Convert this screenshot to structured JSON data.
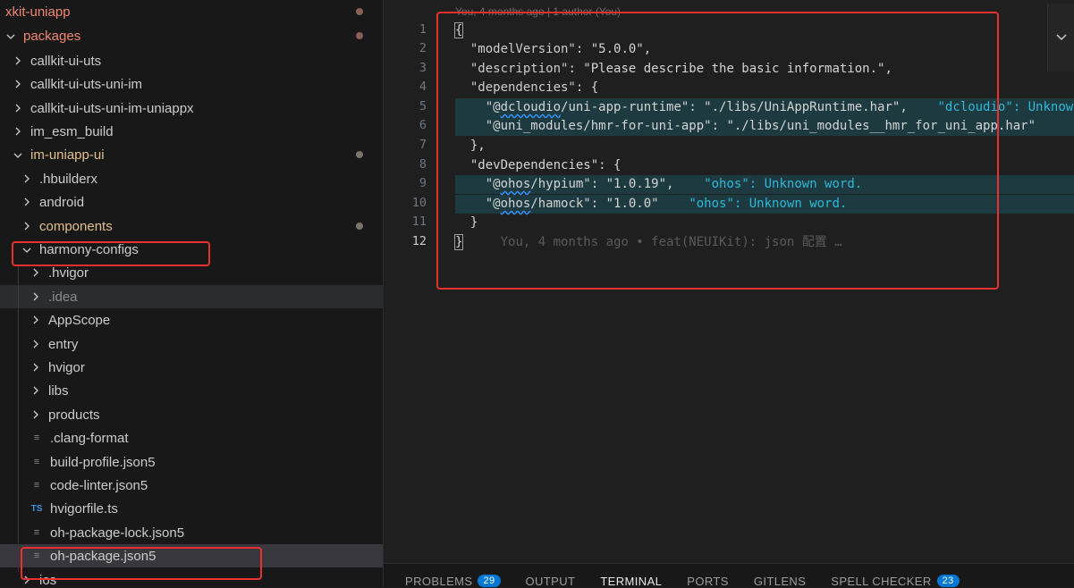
{
  "sidebar": {
    "items": [
      {
        "label": "xkit-uniapp",
        "chevron": "",
        "icon": "",
        "color": "red",
        "dot": "red"
      },
      {
        "label": "packages",
        "chevron": "down",
        "icon": "",
        "color": "red",
        "dot": "red"
      },
      {
        "label": "callkit-ui-uts",
        "chevron": "right",
        "icon": "",
        "color": "",
        "dot": ""
      },
      {
        "label": "callkit-ui-uts-uni-im",
        "chevron": "right",
        "icon": "",
        "color": "",
        "dot": ""
      },
      {
        "label": "callkit-ui-uts-uni-im-uniappx",
        "chevron": "right",
        "icon": "",
        "color": "",
        "dot": ""
      },
      {
        "label": "im_esm_build",
        "chevron": "right",
        "icon": "",
        "color": "",
        "dot": ""
      },
      {
        "label": "im-uniapp-ui",
        "chevron": "down",
        "icon": "",
        "color": "yellow",
        "dot": "gray"
      },
      {
        "label": ".hbuilderx",
        "chevron": "right",
        "icon": "",
        "color": "",
        "dot": ""
      },
      {
        "label": "android",
        "chevron": "right",
        "icon": "",
        "color": "",
        "dot": ""
      },
      {
        "label": "components",
        "chevron": "right",
        "icon": "",
        "color": "yellow",
        "dot": "gray"
      },
      {
        "label": "harmony-configs",
        "chevron": "down",
        "icon": "",
        "color": "",
        "dot": ""
      },
      {
        "label": ".hvigor",
        "chevron": "right",
        "icon": "",
        "color": "",
        "dot": ""
      },
      {
        "label": ".idea",
        "chevron": "right",
        "icon": "",
        "color": "dim",
        "dot": ""
      },
      {
        "label": "AppScope",
        "chevron": "right",
        "icon": "",
        "color": "",
        "dot": ""
      },
      {
        "label": "entry",
        "chevron": "right",
        "icon": "",
        "color": "",
        "dot": ""
      },
      {
        "label": "hvigor",
        "chevron": "right",
        "icon": "",
        "color": "",
        "dot": ""
      },
      {
        "label": "libs",
        "chevron": "right",
        "icon": "",
        "color": "",
        "dot": ""
      },
      {
        "label": "products",
        "chevron": "right",
        "icon": "",
        "color": "",
        "dot": ""
      },
      {
        "label": ".clang-format",
        "chevron": "",
        "icon": "lines",
        "color": "",
        "dot": ""
      },
      {
        "label": "build-profile.json5",
        "chevron": "",
        "icon": "lines",
        "color": "",
        "dot": ""
      },
      {
        "label": "code-linter.json5",
        "chevron": "",
        "icon": "lines",
        "color": "",
        "dot": ""
      },
      {
        "label": "hvigorfile.ts",
        "chevron": "",
        "icon": "ts",
        "color": "",
        "dot": ""
      },
      {
        "label": "oh-package-lock.json5",
        "chevron": "",
        "icon": "lines",
        "color": "",
        "dot": ""
      },
      {
        "label": "oh-package.json5",
        "chevron": "",
        "icon": "lines",
        "color": "",
        "dot": ""
      },
      {
        "label": "ios",
        "chevron": "right",
        "icon": "",
        "color": "",
        "dot": ""
      }
    ],
    "icon_text": {
      "ts": "TS",
      "lines": "≡"
    }
  },
  "editor": {
    "blame_header": "You, 4 months ago | 1 author (You)",
    "line_numbers": [
      "1",
      "2",
      "3",
      "4",
      "5",
      "6",
      "7",
      "8",
      "9",
      "10",
      "11",
      "12"
    ],
    "inline_blame": "You, 4 months ago • feat(NEUIKit): json 配置 …",
    "code": {
      "l1": "{",
      "l2_key": "\"modelVersion\"",
      "l2_val": "\"5.0.0\"",
      "l3_key": "\"description\"",
      "l3_val": "\"Please describe the basic information.\"",
      "l4_key": "\"dependencies\"",
      "l5_key_a": "\"@",
      "l5_key_b": "dcloudio",
      "l5_key_c": "/uni-app-runtime\"",
      "l5_val": "\"./libs/UniAppRuntime.har\"",
      "l5_warn": "\"dcloudio\": Unknown word.",
      "l6_key": "\"@uni_modules/hmr-for-uni-app\"",
      "l6_val": "\"./libs/uni_modules__hmr_for_uni_app.har\"",
      "l7": "},",
      "l8_key": "\"devDependencies\"",
      "l9_key_a": "\"@",
      "l9_key_b": "ohos",
      "l9_key_c": "/hypium\"",
      "l9_val": "\"1.0.19\"",
      "l9_warn": "\"ohos\": Unknown word.",
      "l10_key_a": "\"@",
      "l10_key_b": "ohos",
      "l10_key_c": "/hamock\"",
      "l10_val": "\"1.0.0\"",
      "l10_warn": "\"ohos\": Unknown word.",
      "l11": "}",
      "l12": "}"
    }
  },
  "panel": {
    "tabs": [
      {
        "label": "PROBLEMS",
        "badge": "29"
      },
      {
        "label": "OUTPUT",
        "badge": ""
      },
      {
        "label": "TERMINAL",
        "badge": ""
      },
      {
        "label": "PORTS",
        "badge": ""
      },
      {
        "label": "GITLENS",
        "badge": ""
      },
      {
        "label": "SPELL CHECKER",
        "badge": "23"
      }
    ]
  },
  "colors": {
    "annotation": "#e8312f",
    "badge": "#0078d4",
    "warning": "#30b8d8"
  },
  "icons": {
    "chevron_right": "chevron-right-icon",
    "chevron_down": "chevron-down-icon"
  }
}
